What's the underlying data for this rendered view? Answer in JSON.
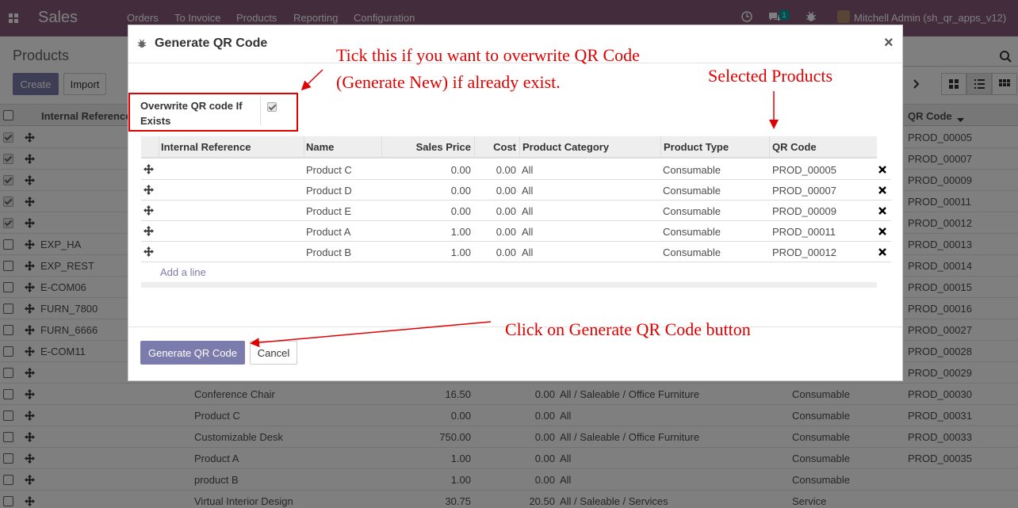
{
  "navbar": {
    "app_title": "Sales",
    "menu": [
      "Orders",
      "To Invoice",
      "Products",
      "Reporting",
      "Configuration"
    ],
    "message_count": "1",
    "user": "Mitchell Admin (sh_qr_apps_v12)"
  },
  "control": {
    "breadcrumb": "Products",
    "create_label": "Create",
    "import_label": "Import"
  },
  "background_list": {
    "headers": {
      "internal_reference": "Internal Reference",
      "qr_code": "QR Code"
    },
    "rows": [
      {
        "checked": true,
        "ref": "",
        "name": "",
        "price": "",
        "cost": "",
        "category": "",
        "type": "",
        "qr": "PROD_00005"
      },
      {
        "checked": true,
        "ref": "",
        "name": "",
        "price": "",
        "cost": "",
        "category": "",
        "type": "",
        "qr": "PROD_00007"
      },
      {
        "checked": true,
        "ref": "",
        "name": "",
        "price": "",
        "cost": "",
        "category": "",
        "type": "",
        "qr": "PROD_00009"
      },
      {
        "checked": true,
        "ref": "",
        "name": "",
        "price": "",
        "cost": "",
        "category": "",
        "type": "",
        "qr": "PROD_00011"
      },
      {
        "checked": true,
        "ref": "",
        "name": "",
        "price": "",
        "cost": "",
        "category": "",
        "type": "",
        "qr": "PROD_00012"
      },
      {
        "checked": false,
        "ref": "EXP_HA",
        "name": "",
        "price": "",
        "cost": "",
        "category": "",
        "type": "",
        "qr": "PROD_00013"
      },
      {
        "checked": false,
        "ref": "EXP_REST",
        "name": "",
        "price": "",
        "cost": "",
        "category": "",
        "type": "",
        "qr": "PROD_00014"
      },
      {
        "checked": false,
        "ref": "E-COM06",
        "name": "",
        "price": "",
        "cost": "",
        "category": "",
        "type": "",
        "qr": "PROD_00015"
      },
      {
        "checked": false,
        "ref": "FURN_7800",
        "name": "",
        "price": "",
        "cost": "",
        "category": "",
        "type": "",
        "qr": "PROD_00016"
      },
      {
        "checked": false,
        "ref": "FURN_6666",
        "name": "",
        "price": "",
        "cost": "",
        "category": "",
        "type": "",
        "qr": "PROD_00027"
      },
      {
        "checked": false,
        "ref": "E-COM11",
        "name": "",
        "price": "",
        "cost": "",
        "category": "",
        "type": "",
        "qr": "PROD_00028"
      },
      {
        "checked": false,
        "ref": "",
        "name": "",
        "price": "",
        "cost": "",
        "category": "",
        "type": "",
        "qr": "PROD_00029"
      },
      {
        "checked": false,
        "ref": "",
        "name": "Conference Chair",
        "price": "16.50",
        "cost": "0.00",
        "category": "All / Saleable / Office Furniture",
        "type": "Consumable",
        "qr": "PROD_00030"
      },
      {
        "checked": false,
        "ref": "",
        "name": "Product C",
        "price": "0.00",
        "cost": "0.00",
        "category": "All",
        "type": "Consumable",
        "qr": "PROD_00031"
      },
      {
        "checked": false,
        "ref": "",
        "name": "Customizable Desk",
        "price": "750.00",
        "cost": "0.00",
        "category": "All / Saleable / Office Furniture",
        "type": "Consumable",
        "qr": "PROD_00033"
      },
      {
        "checked": false,
        "ref": "",
        "name": "Product A",
        "price": "1.00",
        "cost": "0.00",
        "category": "All",
        "type": "Consumable",
        "qr": "PROD_00035"
      },
      {
        "checked": false,
        "ref": "",
        "name": "product B",
        "price": "1.00",
        "cost": "0.00",
        "category": "All",
        "type": "Consumable",
        "qr": ""
      },
      {
        "checked": false,
        "ref": "",
        "name": "Virtual Interior Design",
        "price": "30.75",
        "cost": "20.50",
        "category": "All / Saleable / Services",
        "type": "Service",
        "qr": ""
      }
    ]
  },
  "modal": {
    "title": "Generate QR Code",
    "close": "×",
    "overwrite_label": "Overwrite QR code If Exists",
    "overwrite_checked": true,
    "columns": [
      "Internal Reference",
      "Name",
      "Sales Price",
      "Cost",
      "Product Category",
      "Product Type",
      "QR Code"
    ],
    "lines": [
      {
        "ref": "",
        "name": "Product C",
        "price": "0.00",
        "cost": "0.00",
        "category": "All",
        "type": "Consumable",
        "qr": "PROD_00005"
      },
      {
        "ref": "",
        "name": "Product D",
        "price": "0.00",
        "cost": "0.00",
        "category": "All",
        "type": "Consumable",
        "qr": "PROD_00007"
      },
      {
        "ref": "",
        "name": "Product E",
        "price": "0.00",
        "cost": "0.00",
        "category": "All",
        "type": "Consumable",
        "qr": "PROD_00009"
      },
      {
        "ref": "",
        "name": "Product A",
        "price": "1.00",
        "cost": "0.00",
        "category": "All",
        "type": "Consumable",
        "qr": "PROD_00011"
      },
      {
        "ref": "",
        "name": "Product B",
        "price": "1.00",
        "cost": "0.00",
        "category": "All",
        "type": "Consumable",
        "qr": "PROD_00012"
      }
    ],
    "add_line": "Add a line",
    "generate_label": "Generate QR Code",
    "cancel_label": "Cancel"
  },
  "annotations": {
    "tick_line1": "Tick this if you want to overwrite QR Code",
    "tick_line2": "(Generate New) if already exist.",
    "selected_products": "Selected Products",
    "click_generate": "Click on Generate QR Code button"
  },
  "colors": {
    "brand": "#875a7b",
    "primary_button": "#7c7bad",
    "annotation": "#e00000"
  }
}
